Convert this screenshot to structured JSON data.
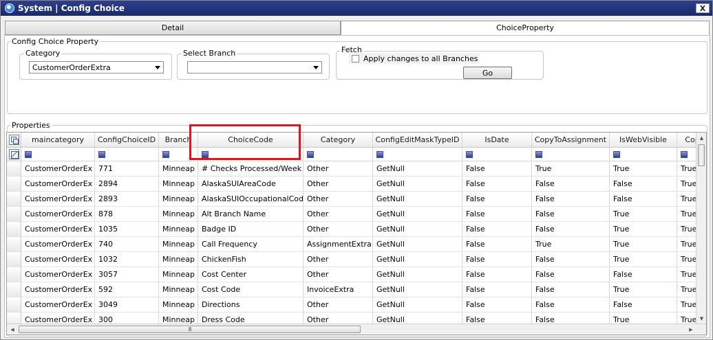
{
  "window": {
    "title": "System | Config Choice",
    "close": "X"
  },
  "tabs": [
    {
      "label": "Detail"
    },
    {
      "label": "ChoiceProperty"
    }
  ],
  "config_group": {
    "legend": "Config Choice Property"
  },
  "category": {
    "legend": "Category",
    "value": "CustomerOrderExtra"
  },
  "branch": {
    "legend": "Select Branch",
    "value": ""
  },
  "fetch": {
    "legend": "Fetch",
    "apply_label": "Apply changes to all Branches",
    "apply_checked": false,
    "go_label": "Go"
  },
  "properties": {
    "legend": "Properties",
    "columns": [
      "maincategory",
      "ConfigChoiceID",
      "Branch",
      "ChoiceCode",
      "Category",
      "ConfigEditMaskTypeID",
      "IsDate",
      "CopyToAssignment",
      "IsWebVisible",
      "Cop"
    ],
    "rows": [
      [
        "CustomerOrderEx",
        "771",
        "Minneap",
        "# Checks Processed/Week",
        "Other",
        "GetNull",
        "False",
        "True",
        "True",
        "True"
      ],
      [
        "CustomerOrderEx",
        "2894",
        "Minneap",
        "AlaskaSUIAreaCode",
        "Other",
        "GetNull",
        "False",
        "False",
        "False",
        "True"
      ],
      [
        "CustomerOrderEx",
        "2893",
        "Minneap",
        "AlaskaSUIOccupationalCode",
        "Other",
        "GetNull",
        "False",
        "False",
        "False",
        "True"
      ],
      [
        "CustomerOrderEx",
        "878",
        "Minneap",
        "Alt Branch Name",
        "Other",
        "GetNull",
        "False",
        "False",
        "True",
        "True"
      ],
      [
        "CustomerOrderEx",
        "1035",
        "Minneap",
        "Badge ID",
        "Other",
        "GetNull",
        "False",
        "False",
        "True",
        "True"
      ],
      [
        "CustomerOrderEx",
        "740",
        "Minneap",
        "Call Frequency",
        "AssignmentExtra",
        "GetNull",
        "False",
        "True",
        "True",
        "True"
      ],
      [
        "CustomerOrderEx",
        "1032",
        "Minneap",
        "ChickenFish",
        "Other",
        "GetNull",
        "False",
        "False",
        "True",
        "True"
      ],
      [
        "CustomerOrderEx",
        "3057",
        "Minneap",
        "Cost Center",
        "Other",
        "GetNull",
        "False",
        "False",
        "False",
        "True"
      ],
      [
        "CustomerOrderEx",
        "592",
        "Minneap",
        "Cost Code",
        "InvoiceExtra",
        "GetNull",
        "False",
        "False",
        "True",
        "True"
      ],
      [
        "CustomerOrderEx",
        "3049",
        "Minneap",
        "Directions",
        "Other",
        "GetNull",
        "False",
        "False",
        "False",
        "True"
      ],
      [
        "CustomerOrderEx",
        "300",
        "Minneap",
        "Dress Code",
        "Other",
        "GetNull",
        "False",
        "False",
        "True",
        "True"
      ]
    ]
  },
  "scrollbar": {
    "hthumb_grip": "III"
  },
  "colors": {
    "highlight": "#e0141e",
    "titlebar": "#1c2a6b"
  }
}
